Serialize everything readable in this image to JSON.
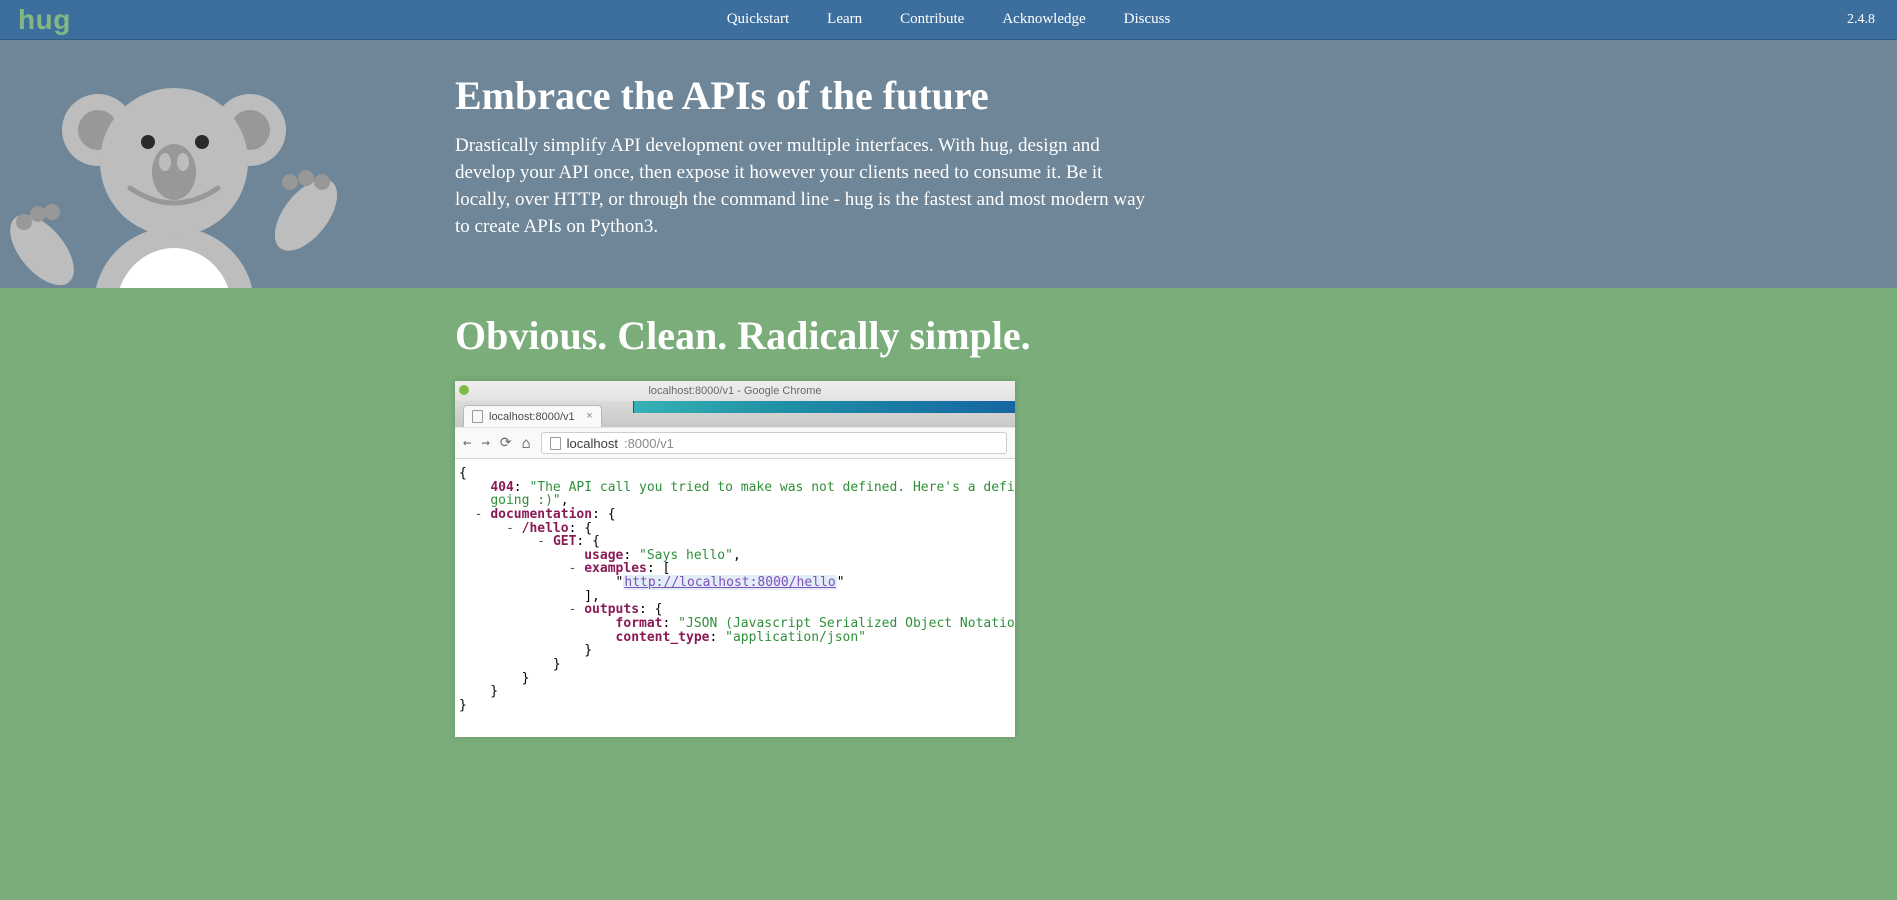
{
  "header": {
    "logo": "hug",
    "nav": [
      "Quickstart",
      "Learn",
      "Contribute",
      "Acknowledge",
      "Discuss"
    ],
    "version": "2.4.8"
  },
  "hero": {
    "title": "Embrace the APIs of the future",
    "body": "Drastically simplify API development over multiple interfaces. With hug, design and develop your API once, then expose it however your clients need to consume it. Be it locally, over HTTP, or through the command line - hug is the fastest and most modern way to create APIs on Python3."
  },
  "section2": {
    "title": "Obvious. Clean. Radically simple."
  },
  "browser": {
    "window_title": "localhost:8000/v1 - Google Chrome",
    "tab_label": "localhost:8000/v1",
    "address_host": "localhost",
    "address_path": ":8000/v1",
    "json": {
      "err_key": "404",
      "err_msg_line1": "\"The API call you tried to make was not defined. Here's a definition of the",
      "err_msg_line2": "going :)\"",
      "doc_key": "documentation",
      "hello_key": "/hello",
      "get_key": "GET",
      "usage_key": "usage",
      "usage_val": "\"Says hello\"",
      "examples_key": "examples",
      "example_url": "http://localhost:8000/hello",
      "outputs_key": "outputs",
      "format_key": "format",
      "format_val": "\"JSON (Javascript Serialized Object Notation)\"",
      "ctype_key": "content_type",
      "ctype_val": "\"application/json\""
    }
  }
}
